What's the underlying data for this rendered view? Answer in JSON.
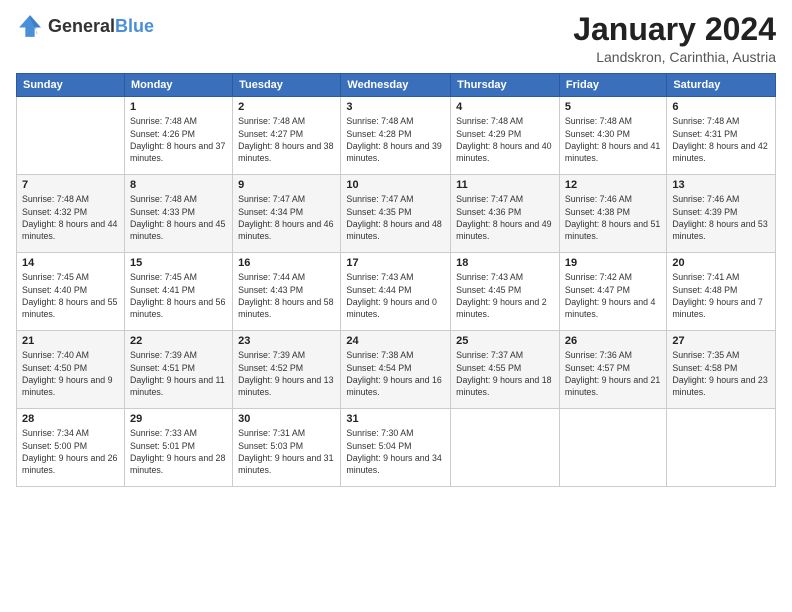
{
  "logo": {
    "general": "General",
    "blue": "Blue"
  },
  "header": {
    "month": "January 2024",
    "location": "Landskron, Carinthia, Austria"
  },
  "weekdays": [
    "Sunday",
    "Monday",
    "Tuesday",
    "Wednesday",
    "Thursday",
    "Friday",
    "Saturday"
  ],
  "weeks": [
    [
      {
        "day": "",
        "sunrise": "",
        "sunset": "",
        "daylight": ""
      },
      {
        "day": "1",
        "sunrise": "Sunrise: 7:48 AM",
        "sunset": "Sunset: 4:26 PM",
        "daylight": "Daylight: 8 hours and 37 minutes."
      },
      {
        "day": "2",
        "sunrise": "Sunrise: 7:48 AM",
        "sunset": "Sunset: 4:27 PM",
        "daylight": "Daylight: 8 hours and 38 minutes."
      },
      {
        "day": "3",
        "sunrise": "Sunrise: 7:48 AM",
        "sunset": "Sunset: 4:28 PM",
        "daylight": "Daylight: 8 hours and 39 minutes."
      },
      {
        "day": "4",
        "sunrise": "Sunrise: 7:48 AM",
        "sunset": "Sunset: 4:29 PM",
        "daylight": "Daylight: 8 hours and 40 minutes."
      },
      {
        "day": "5",
        "sunrise": "Sunrise: 7:48 AM",
        "sunset": "Sunset: 4:30 PM",
        "daylight": "Daylight: 8 hours and 41 minutes."
      },
      {
        "day": "6",
        "sunrise": "Sunrise: 7:48 AM",
        "sunset": "Sunset: 4:31 PM",
        "daylight": "Daylight: 8 hours and 42 minutes."
      }
    ],
    [
      {
        "day": "7",
        "sunrise": "Sunrise: 7:48 AM",
        "sunset": "Sunset: 4:32 PM",
        "daylight": "Daylight: 8 hours and 44 minutes."
      },
      {
        "day": "8",
        "sunrise": "Sunrise: 7:48 AM",
        "sunset": "Sunset: 4:33 PM",
        "daylight": "Daylight: 8 hours and 45 minutes."
      },
      {
        "day": "9",
        "sunrise": "Sunrise: 7:47 AM",
        "sunset": "Sunset: 4:34 PM",
        "daylight": "Daylight: 8 hours and 46 minutes."
      },
      {
        "day": "10",
        "sunrise": "Sunrise: 7:47 AM",
        "sunset": "Sunset: 4:35 PM",
        "daylight": "Daylight: 8 hours and 48 minutes."
      },
      {
        "day": "11",
        "sunrise": "Sunrise: 7:47 AM",
        "sunset": "Sunset: 4:36 PM",
        "daylight": "Daylight: 8 hours and 49 minutes."
      },
      {
        "day": "12",
        "sunrise": "Sunrise: 7:46 AM",
        "sunset": "Sunset: 4:38 PM",
        "daylight": "Daylight: 8 hours and 51 minutes."
      },
      {
        "day": "13",
        "sunrise": "Sunrise: 7:46 AM",
        "sunset": "Sunset: 4:39 PM",
        "daylight": "Daylight: 8 hours and 53 minutes."
      }
    ],
    [
      {
        "day": "14",
        "sunrise": "Sunrise: 7:45 AM",
        "sunset": "Sunset: 4:40 PM",
        "daylight": "Daylight: 8 hours and 55 minutes."
      },
      {
        "day": "15",
        "sunrise": "Sunrise: 7:45 AM",
        "sunset": "Sunset: 4:41 PM",
        "daylight": "Daylight: 8 hours and 56 minutes."
      },
      {
        "day": "16",
        "sunrise": "Sunrise: 7:44 AM",
        "sunset": "Sunset: 4:43 PM",
        "daylight": "Daylight: 8 hours and 58 minutes."
      },
      {
        "day": "17",
        "sunrise": "Sunrise: 7:43 AM",
        "sunset": "Sunset: 4:44 PM",
        "daylight": "Daylight: 9 hours and 0 minutes."
      },
      {
        "day": "18",
        "sunrise": "Sunrise: 7:43 AM",
        "sunset": "Sunset: 4:45 PM",
        "daylight": "Daylight: 9 hours and 2 minutes."
      },
      {
        "day": "19",
        "sunrise": "Sunrise: 7:42 AM",
        "sunset": "Sunset: 4:47 PM",
        "daylight": "Daylight: 9 hours and 4 minutes."
      },
      {
        "day": "20",
        "sunrise": "Sunrise: 7:41 AM",
        "sunset": "Sunset: 4:48 PM",
        "daylight": "Daylight: 9 hours and 7 minutes."
      }
    ],
    [
      {
        "day": "21",
        "sunrise": "Sunrise: 7:40 AM",
        "sunset": "Sunset: 4:50 PM",
        "daylight": "Daylight: 9 hours and 9 minutes."
      },
      {
        "day": "22",
        "sunrise": "Sunrise: 7:39 AM",
        "sunset": "Sunset: 4:51 PM",
        "daylight": "Daylight: 9 hours and 11 minutes."
      },
      {
        "day": "23",
        "sunrise": "Sunrise: 7:39 AM",
        "sunset": "Sunset: 4:52 PM",
        "daylight": "Daylight: 9 hours and 13 minutes."
      },
      {
        "day": "24",
        "sunrise": "Sunrise: 7:38 AM",
        "sunset": "Sunset: 4:54 PM",
        "daylight": "Daylight: 9 hours and 16 minutes."
      },
      {
        "day": "25",
        "sunrise": "Sunrise: 7:37 AM",
        "sunset": "Sunset: 4:55 PM",
        "daylight": "Daylight: 9 hours and 18 minutes."
      },
      {
        "day": "26",
        "sunrise": "Sunrise: 7:36 AM",
        "sunset": "Sunset: 4:57 PM",
        "daylight": "Daylight: 9 hours and 21 minutes."
      },
      {
        "day": "27",
        "sunrise": "Sunrise: 7:35 AM",
        "sunset": "Sunset: 4:58 PM",
        "daylight": "Daylight: 9 hours and 23 minutes."
      }
    ],
    [
      {
        "day": "28",
        "sunrise": "Sunrise: 7:34 AM",
        "sunset": "Sunset: 5:00 PM",
        "daylight": "Daylight: 9 hours and 26 minutes."
      },
      {
        "day": "29",
        "sunrise": "Sunrise: 7:33 AM",
        "sunset": "Sunset: 5:01 PM",
        "daylight": "Daylight: 9 hours and 28 minutes."
      },
      {
        "day": "30",
        "sunrise": "Sunrise: 7:31 AM",
        "sunset": "Sunset: 5:03 PM",
        "daylight": "Daylight: 9 hours and 31 minutes."
      },
      {
        "day": "31",
        "sunrise": "Sunrise: 7:30 AM",
        "sunset": "Sunset: 5:04 PM",
        "daylight": "Daylight: 9 hours and 34 minutes."
      },
      {
        "day": "",
        "sunrise": "",
        "sunset": "",
        "daylight": ""
      },
      {
        "day": "",
        "sunrise": "",
        "sunset": "",
        "daylight": ""
      },
      {
        "day": "",
        "sunrise": "",
        "sunset": "",
        "daylight": ""
      }
    ]
  ]
}
